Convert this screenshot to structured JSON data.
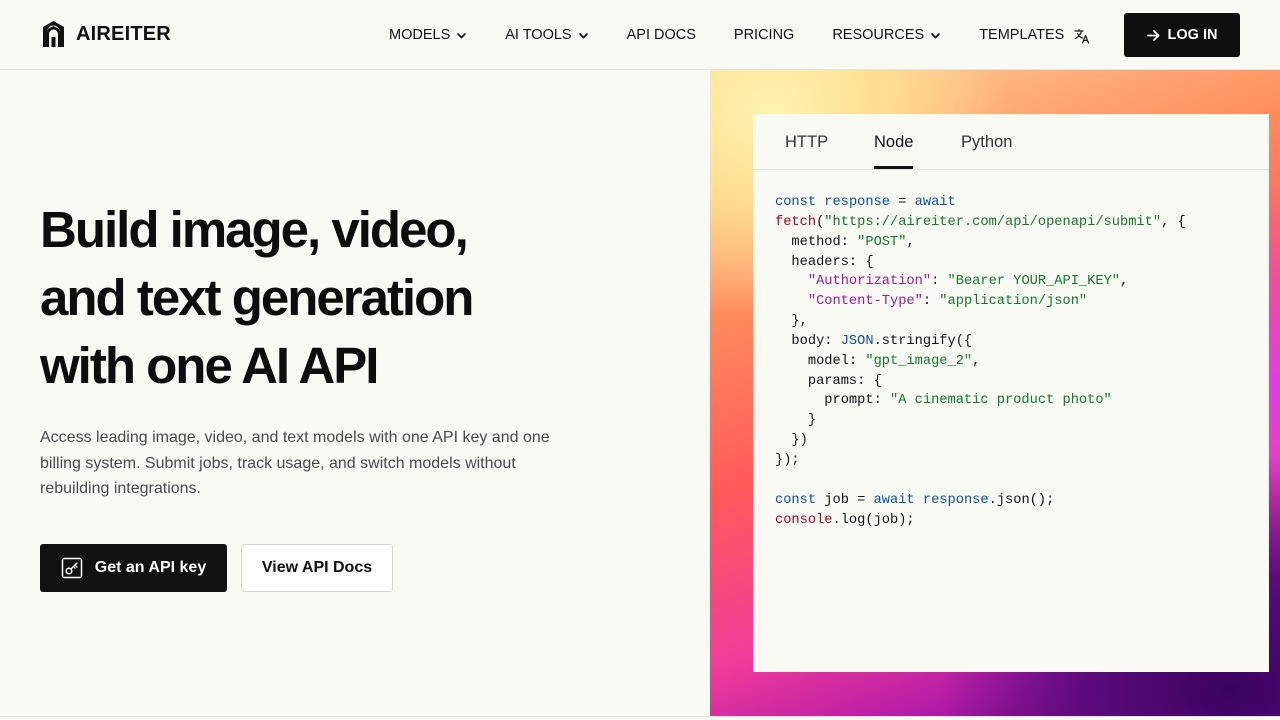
{
  "header": {
    "brand": "AIREITER",
    "nav": [
      {
        "label": "MODELS",
        "dropdown": true
      },
      {
        "label": "AI TOOLS",
        "dropdown": true
      },
      {
        "label": "API DOCS",
        "dropdown": false
      },
      {
        "label": "PRICING",
        "dropdown": false
      },
      {
        "label": "RESOURCES",
        "dropdown": true
      },
      {
        "label": "TEMPLATES",
        "dropdown": false
      }
    ],
    "translate_icon": "translate-icon",
    "login_label": "LOG IN"
  },
  "hero": {
    "title_lines": [
      "Build image, video,",
      "and text generation",
      "with one AI API"
    ],
    "description": "Access leading image, video, and text models with one API key and one billing system. Submit jobs, track usage, and switch models without rebuilding integrations.",
    "primary_button": "Get an API key",
    "secondary_button": "View API Docs"
  },
  "code_panel": {
    "tabs": [
      "HTTP",
      "Node",
      "Python"
    ],
    "active_tab": "Node",
    "lines": [
      [
        [
          "kw",
          "const"
        ],
        [
          "",
          "response"
        ],
        [
          "plain",
          " = "
        ],
        [
          "kw",
          "await"
        ]
      ],
      [
        [
          "fn",
          "fetch"
        ],
        [
          "plain",
          "("
        ],
        [
          "str",
          "\"https://aireiter.com/api/openapi/submit\""
        ],
        [
          "plain",
          ", {"
        ]
      ],
      [
        [
          "plain",
          "  method: "
        ],
        [
          "str",
          "\"POST\""
        ],
        [
          "plain",
          ","
        ]
      ],
      [
        [
          "plain",
          "  headers: {"
        ]
      ],
      [
        [
          "plain",
          "    "
        ],
        [
          "key",
          "\"Authorization\""
        ],
        [
          "plain",
          ": "
        ],
        [
          "str",
          "\"Bearer YOUR_API_KEY\""
        ],
        [
          "plain",
          ","
        ]
      ],
      [
        [
          "plain",
          "    "
        ],
        [
          "key",
          "\"Content-Type\""
        ],
        [
          "plain",
          ": "
        ],
        [
          "str",
          "\"application/json\""
        ]
      ],
      [
        [
          "plain",
          "  },"
        ]
      ],
      [
        [
          "plain",
          "  body: "
        ],
        [
          "kw",
          "JSON"
        ],
        [
          "plain",
          ".stringify({"
        ]
      ],
      [
        [
          "plain",
          "    model: "
        ],
        [
          "str",
          "\"gpt_image_2\""
        ],
        [
          "plain",
          ","
        ]
      ],
      [
        [
          "plain",
          "    params: {"
        ]
      ],
      [
        [
          "plain",
          "      prompt: "
        ],
        [
          "str",
          "\"A cinematic product photo\""
        ]
      ],
      [
        [
          "plain",
          "    }"
        ]
      ],
      [
        [
          "plain",
          "  })"
        ]
      ],
      [
        [
          "plain",
          "});"
        ]
      ],
      [
        [
          "plain",
          ""
        ]
      ],
      [
        [
          "kw",
          "const"
        ],
        [
          "plain",
          " job = "
        ],
        [
          "kw",
          "await"
        ],
        [
          "plain",
          " "
        ],
        [
          "kw",
          "response"
        ],
        [
          "plain",
          ".json();"
        ]
      ],
      [
        [
          "fn",
          "console"
        ],
        [
          "plain",
          ".log(job);"
        ]
      ]
    ]
  },
  "colors": {
    "primary_button_bg": "#111111",
    "keyword": "#0b4fb0",
    "function": "#b3001b",
    "string": "#127a2a",
    "object_key": "#a0189a"
  }
}
